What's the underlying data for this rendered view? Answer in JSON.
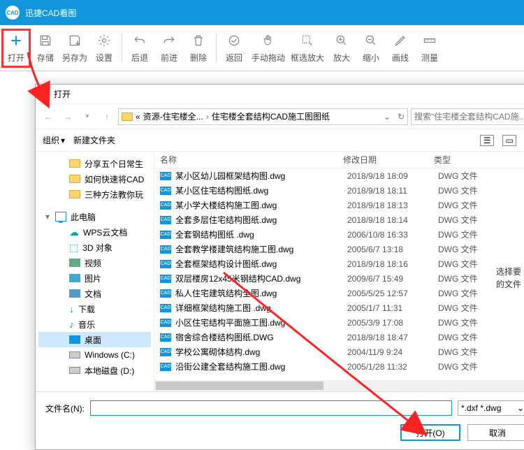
{
  "app": {
    "title": "迅捷CAD看图",
    "logo_text": "CAD"
  },
  "toolbar": {
    "open": "打开",
    "save": "存储",
    "saveas": "另存为",
    "settings": "设置",
    "back": "后退",
    "forward": "前进",
    "delete": "删除",
    "return": "返回",
    "pan": "手动拖动",
    "zoombox": "框选放大",
    "zoomin": "放大",
    "zoomout": "缩小",
    "line": "画线",
    "measure": "测量"
  },
  "dialog": {
    "title": "打开",
    "breadcrumbs": {
      "prefix": "«",
      "seg1": "资源-住宅楼全...",
      "seg2": "住宅楼全套结构CAD施工图图纸"
    },
    "search_placeholder": "搜索\"住宅楼全套结构CAD施...",
    "organize": "组织",
    "newfolder": "新建文件夹",
    "columns": {
      "name": "名称",
      "date": "修改日期",
      "type": "类型"
    },
    "filename_label": "文件名(N):",
    "filetype": "*.dxf *.dwg",
    "open_btn": "打开(O)",
    "cancel_btn": "取消",
    "side_hint_1": "选择要",
    "side_hint_2": "的文件"
  },
  "tree": [
    {
      "label": "分享五个日常生",
      "icon": "folder",
      "indent": "sub"
    },
    {
      "label": "如何快速将CAD",
      "icon": "folder",
      "indent": "sub"
    },
    {
      "label": "三种方法教你玩",
      "icon": "folder",
      "indent": "sub"
    },
    {
      "label": "",
      "blank": true
    },
    {
      "label": "此电脑",
      "icon": "pc",
      "chev": "▾"
    },
    {
      "label": "WPS云文档",
      "icon": "cloud",
      "indent": "sub"
    },
    {
      "label": "3D 对象",
      "icon": "3d",
      "indent": "sub"
    },
    {
      "label": "视频",
      "icon": "vid",
      "indent": "sub"
    },
    {
      "label": "图片",
      "icon": "img",
      "indent": "sub"
    },
    {
      "label": "文档",
      "icon": "doc",
      "indent": "sub"
    },
    {
      "label": "下载",
      "icon": "dl",
      "indent": "sub"
    },
    {
      "label": "音乐",
      "icon": "music",
      "indent": "sub"
    },
    {
      "label": "桌面",
      "icon": "desktop",
      "indent": "sub",
      "selected": true
    },
    {
      "label": "Windows (C:)",
      "icon": "drive",
      "indent": "sub"
    },
    {
      "label": "本地磁盘 (D:)",
      "icon": "drive",
      "indent": "sub"
    }
  ],
  "files": [
    {
      "name": "某小区幼儿园框架结构图.dwg",
      "date": "2018/9/18 18:09",
      "type": "DWG 文件"
    },
    {
      "name": "某小区住宅结构图纸.dwg",
      "date": "2018/9/18 18:11",
      "type": "DWG 文件"
    },
    {
      "name": "某小学大楼结构施工图.dwg",
      "date": "2018/9/18 18:13",
      "type": "DWG 文件"
    },
    {
      "name": "全套多层住宅结构图纸.dwg",
      "date": "2018/9/18 18:14",
      "type": "DWG 文件"
    },
    {
      "name": "全套钢结构图纸 .dwg",
      "date": "2006/10/8 16:33",
      "type": "DWG 文件"
    },
    {
      "name": "全套教学楼建筑结构施工图.dwg",
      "date": "2005/6/7 13:18",
      "type": "DWG 文件"
    },
    {
      "name": "全套框架结构设计图纸.dwg",
      "date": "2018/9/18 18:16",
      "type": "DWG 文件"
    },
    {
      "name": "双层楼房12x45米钢结构CAD.dwg",
      "date": "2009/6/7 15:49",
      "type": "DWG 文件"
    },
    {
      "name": "私人住宅建筑结构全图.dwg",
      "date": "2005/5/25 12:57",
      "type": "DWG 文件"
    },
    {
      "name": "详细框架结构施工图 .dwg",
      "date": "2005/1/7 11:31",
      "type": "DWG 文件"
    },
    {
      "name": "小区住宅结构平面施工图.dwg",
      "date": "2005/3/9 17:08",
      "type": "DWG 文件"
    },
    {
      "name": "宿舍综合楼结构图纸.DWG",
      "date": "2018/9/18 18:47",
      "type": "DWG 文件"
    },
    {
      "name": "学校公寓砌体结构.dwg",
      "date": "2004/11/9 9:24",
      "type": "DWG 文件"
    },
    {
      "name": "沿街公建全套结构施工图.dwg",
      "date": "2005/1/28 11:32",
      "type": "DWG 文件"
    }
  ]
}
